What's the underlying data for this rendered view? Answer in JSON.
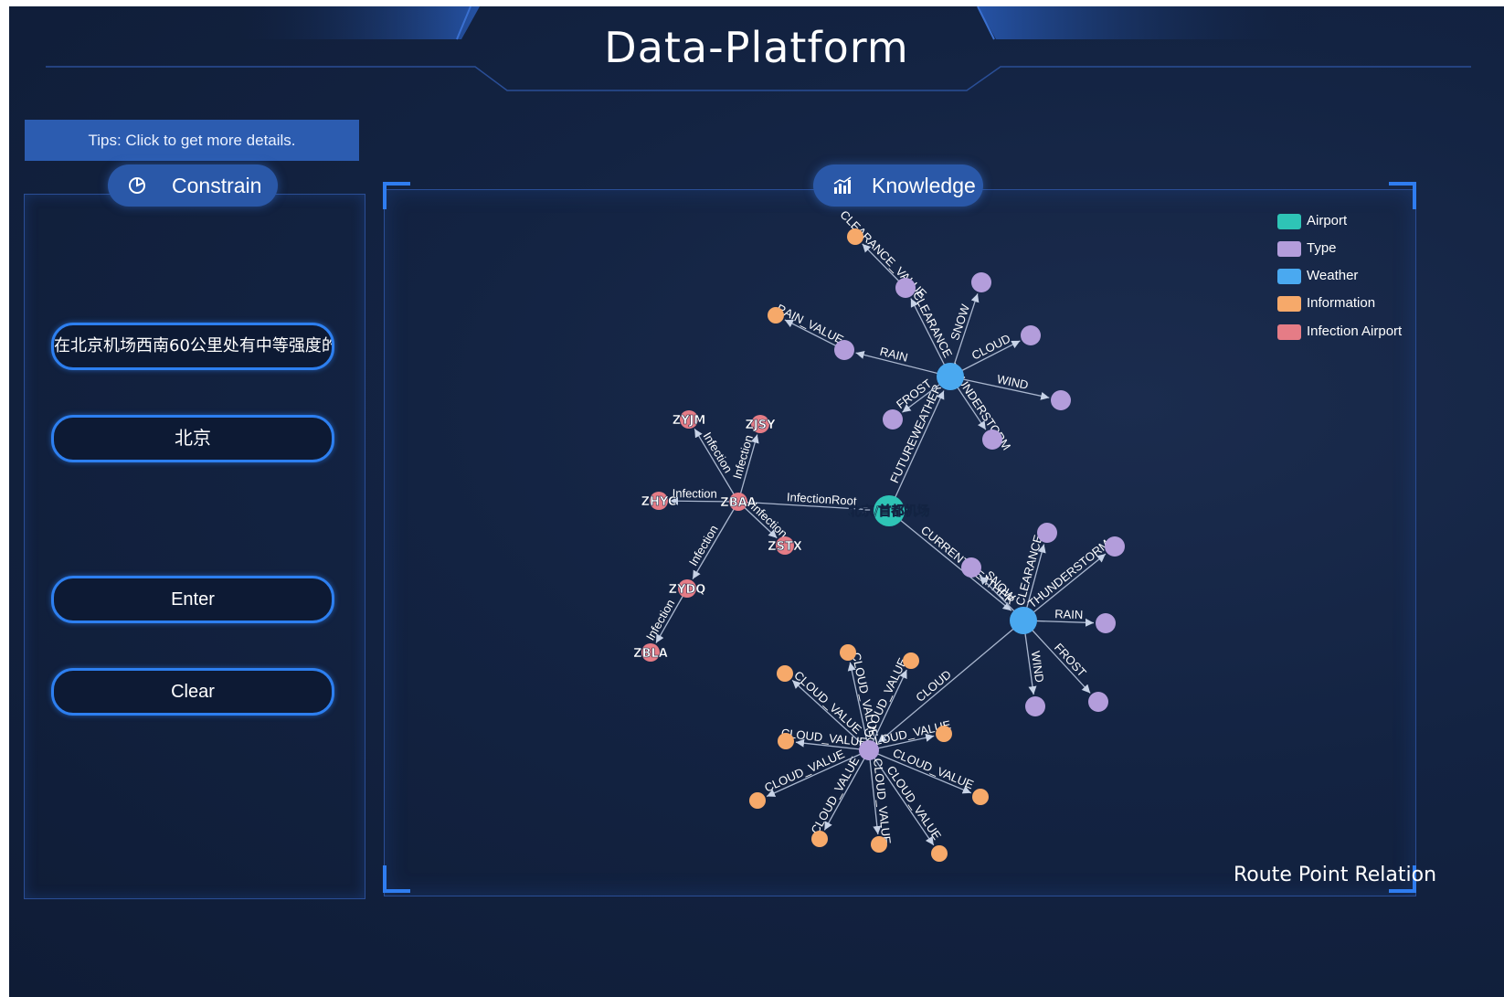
{
  "app": {
    "title": "Data-Platform"
  },
  "tips": "Tips: Click to get more details.",
  "constrain": {
    "header": "Constrain",
    "header_icon": "pie-chart-icon",
    "query_value": "在北京机场西南60公里处有中等强度的",
    "location_value": "北京",
    "enter_label": "Enter",
    "clear_label": "Clear"
  },
  "knowledge": {
    "header": "Knowledge",
    "header_icon": "bar-chart-icon",
    "footer_label": "Route Point Relation",
    "legend": [
      {
        "label": "Airport",
        "color": "#2ec4b6"
      },
      {
        "label": "Type",
        "color": "#b39ddb"
      },
      {
        "label": "Weather",
        "color": "#4aa9f0"
      },
      {
        "label": "Information",
        "color": "#f6a96a"
      },
      {
        "label": "Infection Airport",
        "color": "#e57c86"
      }
    ],
    "graph": {
      "nodes": [
        {
          "id": "airport",
          "label": "北京/首都机场",
          "category": "Airport"
        },
        {
          "id": "zbaa",
          "label": "ZBAA",
          "category": "Infection Airport"
        },
        {
          "id": "zyjm",
          "label": "ZYJM",
          "category": "Infection Airport"
        },
        {
          "id": "zjsy",
          "label": "ZJSY",
          "category": "Infection Airport"
        },
        {
          "id": "zhyc",
          "label": "ZHYC",
          "category": "Infection Airport"
        },
        {
          "id": "zstx",
          "label": "ZSTX",
          "category": "Infection Airport"
        },
        {
          "id": "zydq",
          "label": "ZYDQ",
          "category": "Infection Airport"
        },
        {
          "id": "zbla",
          "label": "ZBLA",
          "category": "Infection Airport"
        },
        {
          "id": "fw",
          "label": "",
          "category": "Weather"
        },
        {
          "id": "cw",
          "label": "",
          "category": "Weather"
        },
        {
          "id": "fwt1",
          "label": "",
          "category": "Type"
        },
        {
          "id": "fwt2",
          "label": "",
          "category": "Type"
        },
        {
          "id": "fwt3",
          "label": "",
          "category": "Type"
        },
        {
          "id": "fwt4",
          "label": "",
          "category": "Type"
        },
        {
          "id": "fwt5",
          "label": "",
          "category": "Type"
        },
        {
          "id": "fwt6",
          "label": "",
          "category": "Type"
        },
        {
          "id": "fwt7",
          "label": "",
          "category": "Type"
        },
        {
          "id": "fwi1",
          "label": "",
          "category": "Information"
        },
        {
          "id": "fwi2",
          "label": "",
          "category": "Information"
        },
        {
          "id": "cwt1",
          "label": "",
          "category": "Type"
        },
        {
          "id": "cwt2",
          "label": "",
          "category": "Type"
        },
        {
          "id": "cwt3",
          "label": "",
          "category": "Type"
        },
        {
          "id": "cwt4",
          "label": "",
          "category": "Type"
        },
        {
          "id": "cwt5",
          "label": "",
          "category": "Type"
        },
        {
          "id": "cwt6",
          "label": "",
          "category": "Type"
        },
        {
          "id": "cloud",
          "label": "",
          "category": "Type"
        },
        {
          "id": "ci1",
          "label": "",
          "category": "Information"
        },
        {
          "id": "ci2",
          "label": "",
          "category": "Information"
        },
        {
          "id": "ci3",
          "label": "",
          "category": "Information"
        },
        {
          "id": "ci4",
          "label": "",
          "category": "Information"
        },
        {
          "id": "ci5",
          "label": "",
          "category": "Information"
        },
        {
          "id": "ci6",
          "label": "",
          "category": "Information"
        },
        {
          "id": "ci7",
          "label": "",
          "category": "Information"
        },
        {
          "id": "ci8",
          "label": "",
          "category": "Information"
        },
        {
          "id": "ci9",
          "label": "",
          "category": "Information"
        },
        {
          "id": "ci10",
          "label": "",
          "category": "Information"
        }
      ],
      "edges": [
        {
          "source": "zbaa",
          "target": "airport",
          "label": "InfectionRoot"
        },
        {
          "source": "zbaa",
          "target": "zyjm",
          "label": "Infection"
        },
        {
          "source": "zbaa",
          "target": "zjsy",
          "label": "Infection"
        },
        {
          "source": "zbaa",
          "target": "zhyc",
          "label": "Infection"
        },
        {
          "source": "zbaa",
          "target": "zstx",
          "label": "Infection"
        },
        {
          "source": "zbaa",
          "target": "zydq",
          "label": "Infection"
        },
        {
          "source": "zydq",
          "target": "zbla",
          "label": "Infection"
        },
        {
          "source": "airport",
          "target": "fw",
          "label": "FUTUREWEATHER"
        },
        {
          "source": "airport",
          "target": "cw",
          "label": "CURRENTWEATHER"
        },
        {
          "source": "fw",
          "target": "fwt1",
          "label": "RAIN"
        },
        {
          "source": "fw",
          "target": "fwt2",
          "label": "CLEARANCE"
        },
        {
          "source": "fw",
          "target": "fwt3",
          "label": "SNOW"
        },
        {
          "source": "fw",
          "target": "fwt4",
          "label": "CLOUD"
        },
        {
          "source": "fw",
          "target": "fwt5",
          "label": "WIND"
        },
        {
          "source": "fw",
          "target": "fwt6",
          "label": "THUNDERSTORM"
        },
        {
          "source": "fw",
          "target": "fwt7",
          "label": "FROST"
        },
        {
          "source": "fwt1",
          "target": "fwi1",
          "label": "RAIN_VALUE"
        },
        {
          "source": "fwt2",
          "target": "fwi2",
          "label": "CLEARANCE_VALUE"
        },
        {
          "source": "cw",
          "target": "cwt1",
          "label": "SNOW"
        },
        {
          "source": "cw",
          "target": "cwt2",
          "label": "CLEARANCE"
        },
        {
          "source": "cw",
          "target": "cwt3",
          "label": "THUNDERSTORM"
        },
        {
          "source": "cw",
          "target": "cwt4",
          "label": "RAIN"
        },
        {
          "source": "cw",
          "target": "cwt5",
          "label": "FROST"
        },
        {
          "source": "cw",
          "target": "cwt6",
          "label": "WIND"
        },
        {
          "source": "cw",
          "target": "cloud",
          "label": "CLOUD"
        },
        {
          "source": "cloud",
          "target": "ci1",
          "label": "CLOUD_VALUE"
        },
        {
          "source": "cloud",
          "target": "ci2",
          "label": "CLOUD_VALUE"
        },
        {
          "source": "cloud",
          "target": "ci3",
          "label": "CLOUD_VALUE"
        },
        {
          "source": "cloud",
          "target": "ci4",
          "label": "CLOUD_VALUE"
        },
        {
          "source": "cloud",
          "target": "ci5",
          "label": "CLOUD_VALUE"
        },
        {
          "source": "cloud",
          "target": "ci6",
          "label": "CLOUD_VALUE"
        },
        {
          "source": "cloud",
          "target": "ci7",
          "label": "CLOUD_VALUE"
        },
        {
          "source": "cloud",
          "target": "ci8",
          "label": "CLOUD_VALUE"
        },
        {
          "source": "cloud",
          "target": "ci9",
          "label": "CLOUD_VALUE"
        },
        {
          "source": "cloud",
          "target": "ci10",
          "label": "CLOUD_VALUE"
        }
      ]
    }
  }
}
